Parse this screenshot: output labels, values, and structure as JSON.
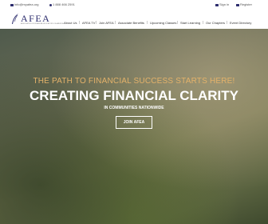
{
  "utility": {
    "email": "info@myafea.org",
    "phone": "1 888 466 2591",
    "sign_in": "Sign in",
    "register": "Register"
  },
  "logo": {
    "text": "AFEA",
    "tagline": "ASSOCIATION OF FINANCIAL EDUCATORS OF AMERICA"
  },
  "nav": {
    "items": [
      "About Us",
      "AFEA TV",
      "Join AFEA",
      "Associate Benefits",
      "Upcoming Classes",
      "Start Learning",
      "Our Chapters",
      "Event Directory"
    ]
  },
  "hero": {
    "tagline": "THE PATH TO FINANCIAL SUCCESS STARTS HERE!",
    "headline": "CREATING FINANCIAL CLARITY",
    "subline": "IN COMMUNITIES NATIONWIDE",
    "cta": "JOIN AFEA"
  },
  "colors": {
    "brand_navy": "#2e2e6e",
    "tagline_gold": "#e4b26a"
  }
}
